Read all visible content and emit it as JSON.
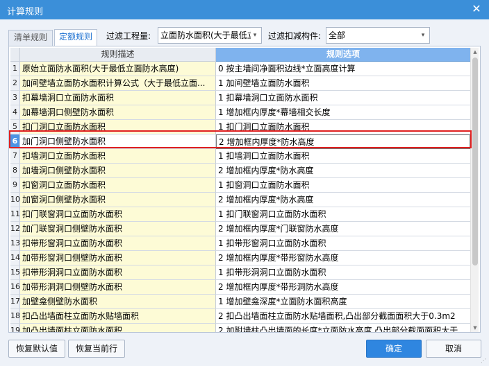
{
  "window": {
    "title": "计算规则",
    "close_glyph": "✕"
  },
  "tabs": [
    {
      "label": "清单规则",
      "active": false
    },
    {
      "label": "定额规则",
      "active": true
    }
  ],
  "filters": {
    "quantity_label": "过滤工程量:",
    "quantity_value": "立面防水面积(大于最低立",
    "deduction_label": "过滤扣减构件:",
    "deduction_value": "全部"
  },
  "table": {
    "columns": [
      "规则描述",
      "规则选项"
    ],
    "selected_row": 6,
    "rows": [
      {
        "num": "1",
        "desc": "原始立面防水面积(大于最低立面防水高度)",
        "opt": "0 按主墙间净面积边线*立面高度计算"
      },
      {
        "num": "2",
        "desc": "加间壁墙立面防水面积计算公式（大于最低立面...",
        "opt": "1 加间壁墙立面防水面积"
      },
      {
        "num": "3",
        "desc": "扣幕墙洞口立面防水面积",
        "opt": "1 扣幕墙洞口立面防水面积"
      },
      {
        "num": "4",
        "desc": "加幕墙洞口侧壁防水面积",
        "opt": "1 增加框内厚度*幕墙相交长度"
      },
      {
        "num": "5",
        "desc": "扣门洞口立面防水面积",
        "opt": "1 扣门洞口立面防水面积"
      },
      {
        "num": "6",
        "desc": "加门洞口侧壁防水面积",
        "opt": "2 增加框内厚度*防水高度"
      },
      {
        "num": "7",
        "desc": "扣墙洞口立面防水面积",
        "opt": "1 扣墙洞口立面防水面积"
      },
      {
        "num": "8",
        "desc": "加墙洞口侧壁防水面积",
        "opt": "2 增加框内厚度*防水高度"
      },
      {
        "num": "9",
        "desc": "扣窗洞口立面防水面积",
        "opt": "1 扣窗洞口立面防水面积"
      },
      {
        "num": "10",
        "desc": "加窗洞口侧壁防水面积",
        "opt": "2 增加框内厚度*防水高度"
      },
      {
        "num": "11",
        "desc": "扣门联窗洞口立面防水面积",
        "opt": "1 扣门联窗洞口立面防水面积"
      },
      {
        "num": "12",
        "desc": "加门联窗洞口侧壁防水面积",
        "opt": "2 增加框内厚度*门联窗防水高度"
      },
      {
        "num": "13",
        "desc": "扣带形窗洞口立面防水面积",
        "opt": "1 扣带形窗洞口立面防水面积"
      },
      {
        "num": "14",
        "desc": "加带形窗洞口侧壁防水面积",
        "opt": "2 增加框内厚度*带形窗防水高度"
      },
      {
        "num": "15",
        "desc": "扣带形洞洞口立面防水面积",
        "opt": "1 扣带形洞洞口立面防水面积"
      },
      {
        "num": "16",
        "desc": "加带形洞洞口侧壁防水面积",
        "opt": "2 增加框内厚度*带形洞防水高度"
      },
      {
        "num": "17",
        "desc": "加壁龛侧壁防水面积",
        "opt": "1 增加壁龛深度*立面防水面积高度"
      },
      {
        "num": "18",
        "desc": "扣凸出墙面柱立面防水贴墙面积",
        "opt": "2 扣凸出墙面柱立面防水贴墙面积,凸出部分截面面积大于0.3m2"
      },
      {
        "num": "19",
        "desc": "加凸出墙面柱立面防水面积",
        "opt": "2 加附墙柱凸出墙面的长度*立面防水高度,凸出部分截面面积大于..."
      }
    ]
  },
  "buttons": {
    "reset_default": "恢复默认值",
    "reset_row": "恢复当前行",
    "ok": "确定",
    "cancel": "取消"
  },
  "icons": {
    "dropdown": "▾",
    "scroll_up": "▲",
    "scroll_down": "▼",
    "resize_grip": "⋰"
  }
}
